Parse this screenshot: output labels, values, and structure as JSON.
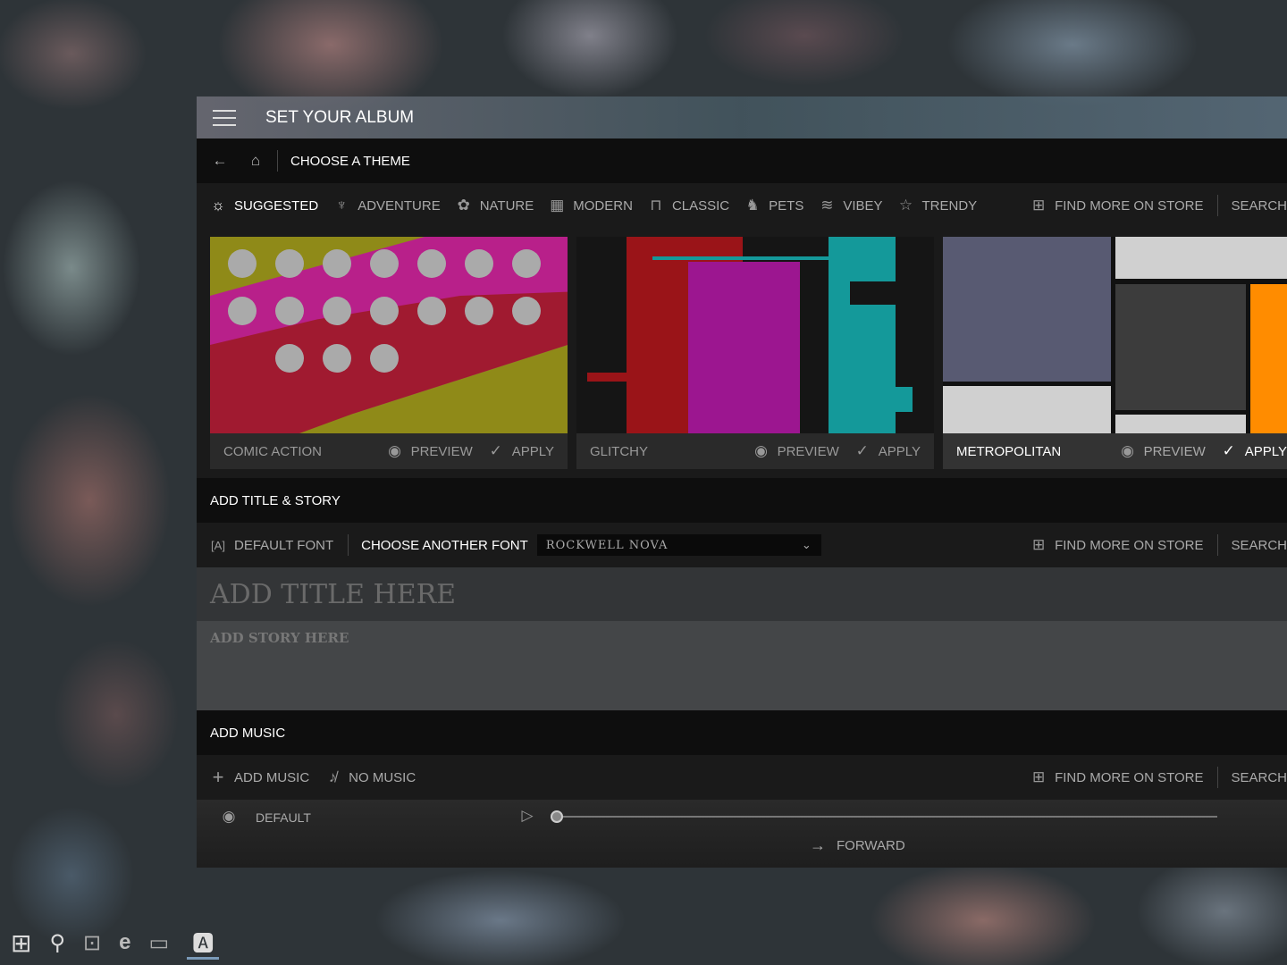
{
  "window": {
    "title": "SET YOUR ALBUM"
  },
  "nav": {
    "breadcrumb": "CHOOSE A THEME"
  },
  "tabs": [
    {
      "label": "SUGGESTED",
      "icon": "lightbulb-icon",
      "selected": true
    },
    {
      "label": "ADVENTURE",
      "icon": "viking-icon"
    },
    {
      "label": "NATURE",
      "icon": "flower-icon"
    },
    {
      "label": "MODERN",
      "icon": "grid-icon"
    },
    {
      "label": "CLASSIC",
      "icon": "curtain-icon"
    },
    {
      "label": "PETS",
      "icon": "dog-icon"
    },
    {
      "label": "VIBEY",
      "icon": "waves-icon"
    },
    {
      "label": "TRENDY",
      "icon": "star-icon"
    }
  ],
  "store": {
    "find_more": "FIND MORE ON STORE",
    "search": "SEARCH"
  },
  "themes": [
    {
      "name": "COMIC ACTION",
      "preview": "PREVIEW",
      "apply": "APPLY"
    },
    {
      "name": "GLITCHY",
      "preview": "PREVIEW",
      "apply": "APPLY"
    },
    {
      "name": "METROPOLITAN",
      "preview": "PREVIEW",
      "apply": "APPLY",
      "selected": true
    }
  ],
  "title_story": {
    "header": "ADD TITLE & STORY",
    "default_font": "DEFAULT FONT",
    "choose_font": "CHOOSE ANOTHER FONT",
    "font_value": "ROCKWELL NOVA",
    "title_placeholder": "ADD TITLE HERE",
    "story_placeholder": "ADD STORY HERE"
  },
  "music": {
    "header": "ADD MUSIC",
    "add": "ADD MUSIC",
    "none": "NO MUSIC",
    "track": "DEFAULT",
    "progress": 0,
    "forward": "FORWARD"
  },
  "taskbar": {
    "icons": [
      "windows-icon",
      "search-icon",
      "store-icon",
      "edge-icon",
      "file-explorer-icon",
      "photos-app-icon"
    ]
  }
}
